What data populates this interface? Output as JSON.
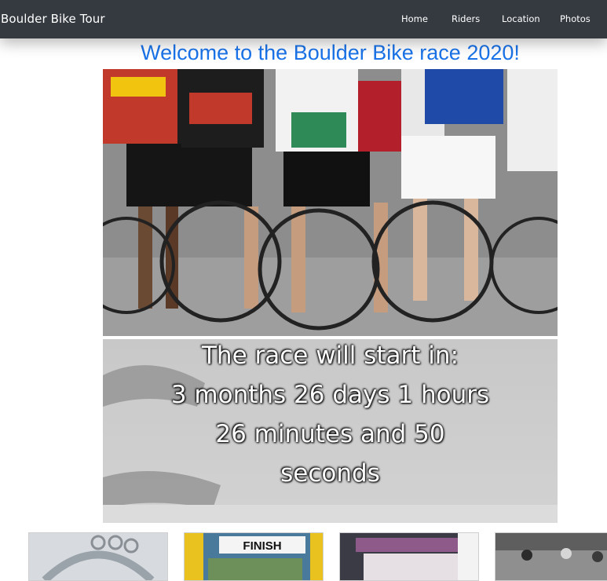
{
  "navbar": {
    "brand": "Boulder Bike Tour",
    "links": [
      {
        "label": "Home"
      },
      {
        "label": "Riders"
      },
      {
        "label": "Location"
      },
      {
        "label": "Photos"
      }
    ]
  },
  "main": {
    "title": "Welcome to the Boulder Bike race 2020!",
    "hero": {
      "image_icon": "cyclists-at-start-line-photo",
      "countdown": {
        "line1": "The race will start in:",
        "line2": "3 months 26 days 1 hours",
        "line3": "26 minutes and 50",
        "line4": "seconds"
      }
    },
    "gallery": [
      {
        "icon": "bike-arch-photo",
        "text": ""
      },
      {
        "icon": "finish-banner-photo",
        "text": "FINISH"
      },
      {
        "icon": "food-stand-photo",
        "text": ""
      },
      {
        "icon": "bw-crowd-photo",
        "text": ""
      }
    ]
  },
  "colors": {
    "navbar_bg": "#343a40",
    "title_blue": "#1a73e8",
    "nav_text": "#ffffff"
  }
}
